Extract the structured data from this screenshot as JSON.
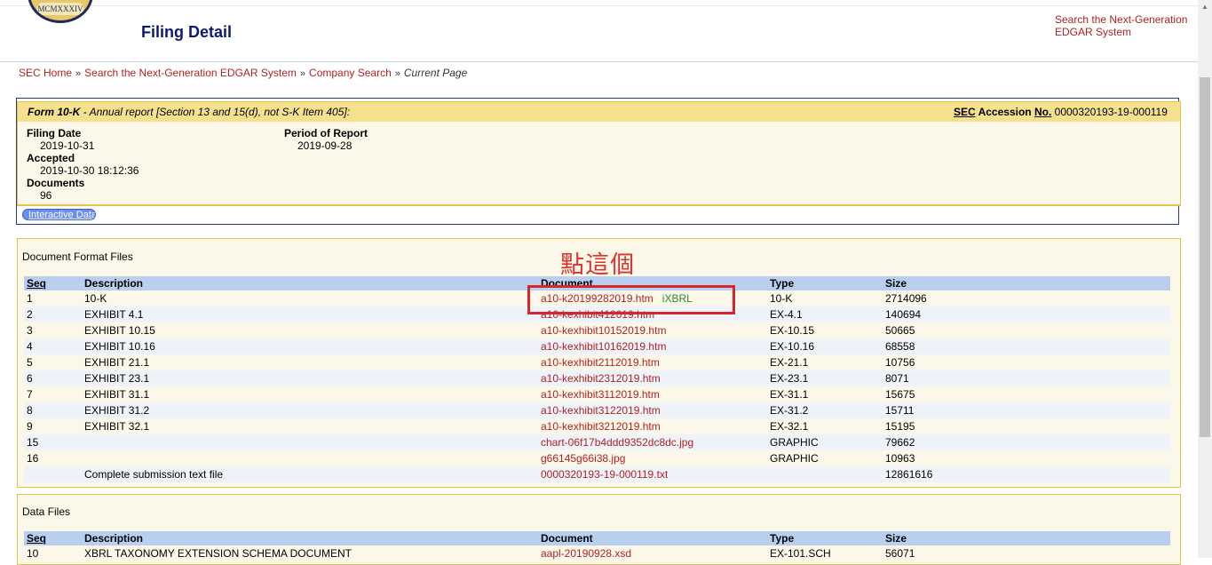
{
  "header": {
    "seal_text": "MCMXXXIV",
    "title": "Filing Detail",
    "right_link": "Search the Next-Generation EDGAR System"
  },
  "breadcrumb": {
    "items": [
      "SEC Home",
      "Search the Next-Generation EDGAR System",
      "Company Search"
    ],
    "separator": "»",
    "current": "Current Page"
  },
  "filing": {
    "form_label": "Form 10-K",
    "form_desc": " - Annual report [Section 13 and 15(d), not S-K Item 405]:",
    "accession_label": "Accession",
    "accession_sec": "SEC",
    "accession_no": "No.",
    "accession_value": "0000320193-19-000119",
    "filing_date_label": "Filing Date",
    "filing_date": "2019-10-31",
    "accepted_label": "Accepted",
    "accepted": "2019-10-30 18:12:36",
    "documents_label": "Documents",
    "documents": "96",
    "period_label": "Period of Report",
    "period": "2019-09-28",
    "interactive_button": "Interactive Data"
  },
  "doc_files": {
    "caption": "Document Format Files",
    "headers": [
      "Seq",
      "Description",
      "Document",
      "Type",
      "Size"
    ],
    "rows": [
      {
        "seq": "1",
        "desc": "10-K",
        "doc": "a10-k20199282019.htm",
        "extra": "iXBRL",
        "type": "10-K",
        "size": "2714096"
      },
      {
        "seq": "2",
        "desc": "EXHIBIT 4.1",
        "doc": "a10-kexhibit412019.htm",
        "extra": "",
        "type": "EX-4.1",
        "size": "140694"
      },
      {
        "seq": "3",
        "desc": "EXHIBIT 10.15",
        "doc": "a10-kexhibit10152019.htm",
        "extra": "",
        "type": "EX-10.15",
        "size": "50665"
      },
      {
        "seq": "4",
        "desc": "EXHIBIT 10.16",
        "doc": "a10-kexhibit10162019.htm",
        "extra": "",
        "type": "EX-10.16",
        "size": "68558"
      },
      {
        "seq": "5",
        "desc": "EXHIBIT 21.1",
        "doc": "a10-kexhibit2112019.htm",
        "extra": "",
        "type": "EX-21.1",
        "size": "10756"
      },
      {
        "seq": "6",
        "desc": "EXHIBIT 23.1",
        "doc": "a10-kexhibit2312019.htm",
        "extra": "",
        "type": "EX-23.1",
        "size": "8071"
      },
      {
        "seq": "7",
        "desc": "EXHIBIT 31.1",
        "doc": "a10-kexhibit3112019.htm",
        "extra": "",
        "type": "EX-31.1",
        "size": "15675"
      },
      {
        "seq": "8",
        "desc": "EXHIBIT 31.2",
        "doc": "a10-kexhibit3122019.htm",
        "extra": "",
        "type": "EX-31.2",
        "size": "15711"
      },
      {
        "seq": "9",
        "desc": "EXHIBIT 32.1",
        "doc": "a10-kexhibit3212019.htm",
        "extra": "",
        "type": "EX-32.1",
        "size": "15195"
      },
      {
        "seq": "15",
        "desc": "",
        "doc": "chart-06f17b4ddd9352dc8dc.jpg",
        "extra": "",
        "type": "GRAPHIC",
        "size": "79662"
      },
      {
        "seq": "16",
        "desc": "",
        "doc": "g66145g66i38.jpg",
        "extra": "",
        "type": "GRAPHIC",
        "size": "10963"
      },
      {
        "seq": "",
        "desc": "Complete submission text file",
        "doc": "0000320193-19-000119.txt",
        "extra": "",
        "type": "",
        "size": "12861616"
      }
    ]
  },
  "data_files": {
    "caption": "Data Files",
    "headers": [
      "Seq",
      "Description",
      "Document",
      "Type",
      "Size"
    ],
    "rows": [
      {
        "seq": "10",
        "desc": "XBRL TAXONOMY EXTENSION SCHEMA DOCUMENT",
        "doc": "aapl-20190928.xsd",
        "extra": "",
        "type": "EX-101.SCH",
        "size": "56071"
      }
    ]
  },
  "annotation": {
    "text": "點這個",
    "color": "#e0302a"
  },
  "colors": {
    "link": "#b22222",
    "title": "#0d1a70",
    "header_bar": "#f5e08d",
    "table_header": "#b8cff0",
    "ixbrl": "#2e8b2e"
  }
}
